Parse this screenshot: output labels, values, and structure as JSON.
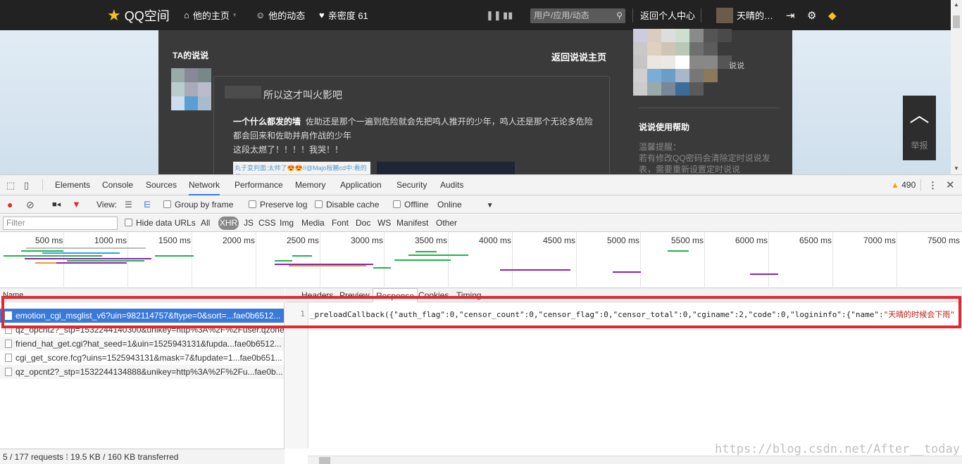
{
  "qq": {
    "logo": "QQ空间",
    "nav": [
      "他的主页",
      "他的动态",
      "亲密度 61"
    ],
    "search_placeholder": "用户/应用/动态",
    "back_personal": "返回个人中心",
    "username": "天晴的…",
    "ta_shuoshuo": "TA的说说",
    "back_shuoshuo": "返回说说主页",
    "post_title": "所以这才叫火影吧",
    "post_author": "一个什么都发的墙",
    "post_body_1": "佐助还是那个一遍到危险就会先把鸣人推开的少年，鸣人还是那个无论多危险都会回来和佐助并肩作战的少年",
    "post_body_2": "这段太燃了！！！！我哭！！",
    "thumb_text": "丸子変判面:太帅了😍😍//@Majo桜麓cd中:看的巨...",
    "side_shuo": "说说",
    "help_title": "说说使用帮助",
    "tip_1": "温馨提醒：",
    "tip_2": "若有修改QQ密码会清除定时说说发表，需要重新设置定时说说",
    "report": "举报"
  },
  "devtools": {
    "tabs": [
      "Elements",
      "Console",
      "Sources",
      "Network",
      "Performance",
      "Memory",
      "Application",
      "Security",
      "Audits"
    ],
    "active_tab": "Network",
    "warnings": "490",
    "toolbar": {
      "view": "View:",
      "group_by_frame": "Group by frame",
      "preserve_log": "Preserve log",
      "disable_cache": "Disable cache",
      "offline": "Offline",
      "online": "Online"
    },
    "filter_placeholder": "Filter",
    "hide_data_urls": "Hide data URLs",
    "type_filters": [
      "All",
      "XHR",
      "JS",
      "CSS",
      "Img",
      "Media",
      "Font",
      "Doc",
      "WS",
      "Manifest",
      "Other"
    ],
    "timeline_labels": [
      "500 ms",
      "1000 ms",
      "1500 ms",
      "2000 ms",
      "2500 ms",
      "3000 ms",
      "3500 ms",
      "4000 ms",
      "4500 ms",
      "5000 ms",
      "5500 ms",
      "6000 ms",
      "6500 ms",
      "7000 ms",
      "7500 ms"
    ],
    "list_header": "Name",
    "requests": [
      "emotion_cgi_msglist_v6?uin=982114757&ftype=0&sort=...fae0b6512...",
      "qz_opcnt2?_stp=1532244140300&unikey=http%3A%2F%2Fuser.qzone...",
      "friend_hat_get.cgi?hat_seed=1&uin=1525943131&fupda...fae0b6512...",
      "cgi_get_score.fcg?uins=1525943131&mask=7&fupdate=1...fae0b651...",
      "qz_opcnt2?_stp=1532244134888&unikey=http%3A%2F%2Fu...fae0b..."
    ],
    "detail_tabs": [
      "Headers",
      "Preview",
      "Response",
      "Cookies",
      "Timing"
    ],
    "active_detail": "Response",
    "line_number": "1",
    "response_prefix": "_preloadCallback({\"auth_flag\":0,\"censor_count\":0,\"censor_flag\":0,\"censor_total\":0,\"cginame\":2,\"code\":0,\"logininfo\":{\"name\":",
    "response_name": "\"天晴的时候会下雨\"",
    "status": "5 / 177 requests  ⁞  19.5 KB / 160 KB transferred"
  },
  "watermark": "https://blog.csdn.net/After__today"
}
